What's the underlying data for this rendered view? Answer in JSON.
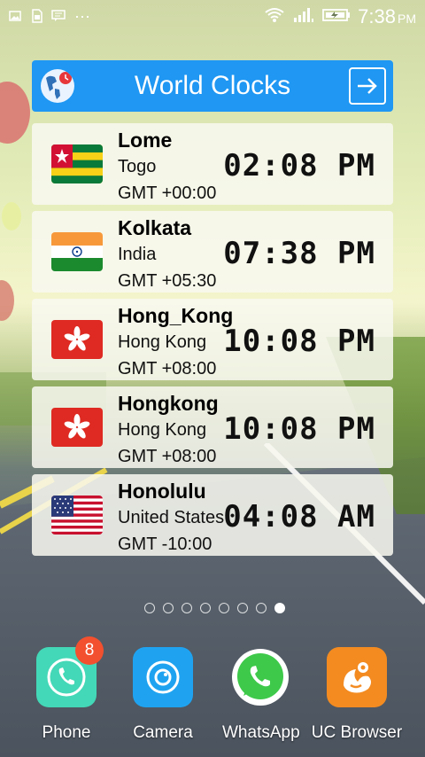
{
  "status_bar": {
    "time": "7:38",
    "ampm": "PM",
    "icons": [
      "image-icon",
      "sim-icon",
      "message-icon",
      "more-icon",
      "wifi-icon",
      "signal-icon",
      "battery-icon"
    ]
  },
  "widget": {
    "title": "World Clocks",
    "icons": [
      "world-clock-globe-icon",
      "exit-icon"
    ],
    "clocks": [
      {
        "city": "Lome",
        "country": "Togo",
        "gmt": "GMT +00:00",
        "time": "02:08 PM",
        "flag": "togo-flag"
      },
      {
        "city": "Kolkata",
        "country": "India",
        "gmt": "GMT +05:30",
        "time": "07:38 PM",
        "flag": "india-flag"
      },
      {
        "city": "Hong_Kong",
        "country": "Hong Kong",
        "gmt": "GMT +08:00",
        "time": "10:08 PM",
        "flag": "hong-kong-flag"
      },
      {
        "city": "Hongkong",
        "country": "Hong Kong",
        "gmt": "GMT +08:00",
        "time": "10:08 PM",
        "flag": "hong-kong-flag"
      },
      {
        "city": "Honolulu",
        "country": "United States",
        "gmt": "GMT -10:00",
        "time": "04:08 AM",
        "flag": "usa-flag"
      }
    ]
  },
  "pager": {
    "count": 8,
    "active_index": 7
  },
  "dock": [
    {
      "label": "Phone",
      "badge": "8",
      "icon": "phone-icon",
      "color": "#43d8b7"
    },
    {
      "label": "Camera",
      "icon": "camera-icon",
      "color": "#1fa3f0"
    },
    {
      "label": "WhatsApp",
      "icon": "whatsapp-icon",
      "color": "#3ec94a"
    },
    {
      "label": "UC Browser",
      "icon": "uc-browser-icon",
      "color": "#f38b21"
    }
  ]
}
